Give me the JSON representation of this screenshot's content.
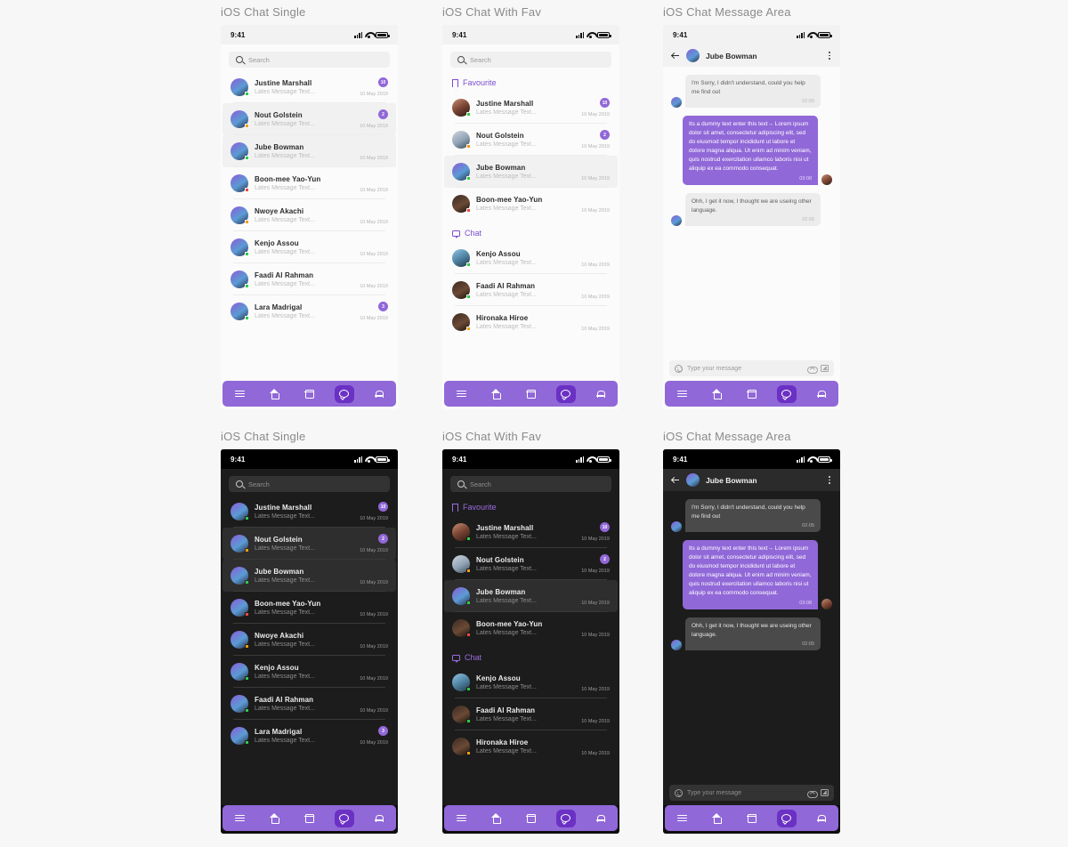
{
  "theme": {
    "accent": "#9168d8",
    "accent_dark": "#6a31c4",
    "accent_text": "#7c4dd0",
    "light_bg": "#fbfbfb",
    "dark_bg": "#1c1c1c"
  },
  "frames": [
    {
      "title": "iOS Chat Single",
      "mode": "light"
    },
    {
      "title": "iOS Chat With Fav",
      "mode": "light"
    },
    {
      "title": "iOS Chat Message Area",
      "mode": "light"
    },
    {
      "title": "iOS Chat Single",
      "mode": "dark"
    },
    {
      "title": "iOS Chat With Fav",
      "mode": "dark"
    },
    {
      "title": "iOS Chat Message Area",
      "mode": "dark"
    }
  ],
  "status_bar": {
    "time": "9:41",
    "signal": "signal-bars-icon",
    "wifi": "wifi-icon",
    "battery": "battery-icon"
  },
  "search": {
    "placeholder": "Search",
    "icon": "search-icon"
  },
  "sections": {
    "favourite": {
      "label": "Favourite",
      "icon": "bookmark-icon"
    },
    "chat": {
      "label": "Chat",
      "icon": "chat-bubble-icon"
    }
  },
  "single_list": [
    {
      "name": "Justine Marshall",
      "message": "Lates Message Text...",
      "date": "10 May 2019",
      "badge": "10",
      "status": "green",
      "avatar": "a",
      "selected": false
    },
    {
      "name": "Nout Golstein",
      "message": "Lates Message Text...",
      "date": "10 May 2019",
      "badge": "2",
      "status": "orange",
      "avatar": "a",
      "selected": true
    },
    {
      "name": "Jube Bowman",
      "message": "Lates Message Text...",
      "date": "10 May 2019",
      "badge": "",
      "status": "green",
      "avatar": "a",
      "selected": true
    },
    {
      "name": "Boon-mee Yao-Yun",
      "message": "Lates Message Text...",
      "date": "10 May 2019",
      "badge": "",
      "status": "red",
      "avatar": "a",
      "selected": false
    },
    {
      "name": "Nwoye Akachi",
      "message": "Lates Message Text...",
      "date": "10 May 2019",
      "badge": "",
      "status": "orange",
      "avatar": "a",
      "selected": false
    },
    {
      "name": "Kenjo Assou",
      "message": "Lates Message Text...",
      "date": "10 May 2019",
      "badge": "",
      "status": "green",
      "avatar": "a",
      "selected": false
    },
    {
      "name": "Faadi Al Rahman",
      "message": "Lates Message Text...",
      "date": "10 May 2019",
      "badge": "",
      "status": "green",
      "avatar": "a",
      "selected": false
    },
    {
      "name": "Lara Madrigal",
      "message": "Lates Message Text...",
      "date": "10 May 2019",
      "badge": "3",
      "status": "green",
      "avatar": "a",
      "selected": false
    }
  ],
  "fav_list": [
    {
      "name": "Justine Marshall",
      "message": "Lates Message Text...",
      "date": "10 May 2019",
      "badge": "10",
      "status": "green",
      "avatar": "b",
      "selected": false
    },
    {
      "name": "Nout Golstein",
      "message": "Lates Message Text...",
      "date": "10 May 2019",
      "badge": "2",
      "status": "orange",
      "avatar": "c",
      "selected": false
    },
    {
      "name": "Jube Bowman",
      "message": "Lates Message Text...",
      "date": "10 May 2019",
      "badge": "",
      "status": "green",
      "avatar": "a",
      "selected": true
    },
    {
      "name": "Boon-mee Yao-Yun",
      "message": "Lates Message Text...",
      "date": "10 May 2019",
      "badge": "",
      "status": "red",
      "avatar": "e",
      "selected": false
    }
  ],
  "chat_list": [
    {
      "name": "Kenjo Assou",
      "message": "Lates Message Text...",
      "date": "10 May 2019",
      "badge": "",
      "status": "green",
      "avatar": "d",
      "selected": false
    },
    {
      "name": "Faadi Al Rahman",
      "message": "Lates Message Text...",
      "date": "10 May 2019",
      "badge": "",
      "status": "green",
      "avatar": "e",
      "selected": false
    },
    {
      "name": "Hironaka Hiroe",
      "message": "Lates Message Text...",
      "date": "10 May 2019",
      "badge": "",
      "status": "orange",
      "avatar": "e",
      "selected": false
    }
  ],
  "conversation": {
    "header": {
      "name": "Jube Bowman",
      "back_icon": "back-arrow-icon",
      "menu_icon": "more-vertical-icon"
    },
    "messages": [
      {
        "dir": "in",
        "text": "I'm Sorry, I didn't understand, could you help me find out",
        "time": "02:05"
      },
      {
        "dir": "out",
        "text": "Its a dummy text enter this text→ Lorem ipsum dolor sit amet, consectetur adipiscing elit, sed do eiusmod tempor incididunt ut labore et dolore magna aliqua. Ut enim ad minim veniam, quis nostrud exercitation ullamco laboris nisi ut aliquip ex ea commodo consequat.",
        "time": "03:08"
      },
      {
        "dir": "in",
        "text": "Ohh, I get it now, I thought we are useing other language.",
        "time": "02:05"
      }
    ],
    "composer": {
      "placeholder": "Type your message",
      "emoji_icon": "smiley-icon",
      "upload_icon": "cloud-upload-icon",
      "image_icon": "image-icon"
    }
  },
  "navbar": {
    "items": [
      {
        "icon": "menu-icon",
        "name": "menu",
        "active": false
      },
      {
        "icon": "home-icon",
        "name": "home",
        "active": false
      },
      {
        "icon": "calendar-icon",
        "name": "calendar",
        "active": false
      },
      {
        "icon": "chat-icon",
        "name": "chat",
        "active": true
      },
      {
        "icon": "bell-icon",
        "name": "notifications",
        "active": false
      }
    ]
  }
}
